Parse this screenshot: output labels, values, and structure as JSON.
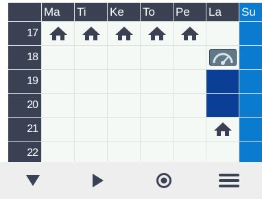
{
  "colors": {
    "header_bg": "#3a4153",
    "weekend_header_bg": "#0b7bd0",
    "cell_bg": "#f5f9f5",
    "highlight_blue": "#0b7bd0",
    "dark_blue": "#0b3f95",
    "icon_color": "#3a4153",
    "toolbar_bg": "#eeeeee"
  },
  "days": [
    {
      "label": "Ma",
      "weekend": false
    },
    {
      "label": "Ti",
      "weekend": false
    },
    {
      "label": "Ke",
      "weekend": false
    },
    {
      "label": "To",
      "weekend": false
    },
    {
      "label": "Pe",
      "weekend": false
    },
    {
      "label": "La",
      "weekend": false
    },
    {
      "label": "Su",
      "weekend": true
    }
  ],
  "hours": [
    "17",
    "18",
    "19",
    "20",
    "21",
    "22"
  ],
  "cells": [
    [
      "home",
      "home",
      "home",
      "home",
      "home",
      "",
      "blue"
    ],
    [
      "",
      "",
      "",
      "",
      "",
      "gauge",
      "blue"
    ],
    [
      "",
      "",
      "",
      "",
      "",
      "dark",
      "blue"
    ],
    [
      "",
      "",
      "",
      "",
      "",
      "dark",
      "blue"
    ],
    [
      "",
      "",
      "",
      "",
      "",
      "home",
      "blue"
    ],
    [
      "",
      "",
      "",
      "",
      "",
      "",
      "blue"
    ]
  ],
  "toolbar": [
    {
      "name": "down-triangle-icon"
    },
    {
      "name": "play-icon"
    },
    {
      "name": "target-circle-icon"
    },
    {
      "name": "menu-icon"
    }
  ]
}
